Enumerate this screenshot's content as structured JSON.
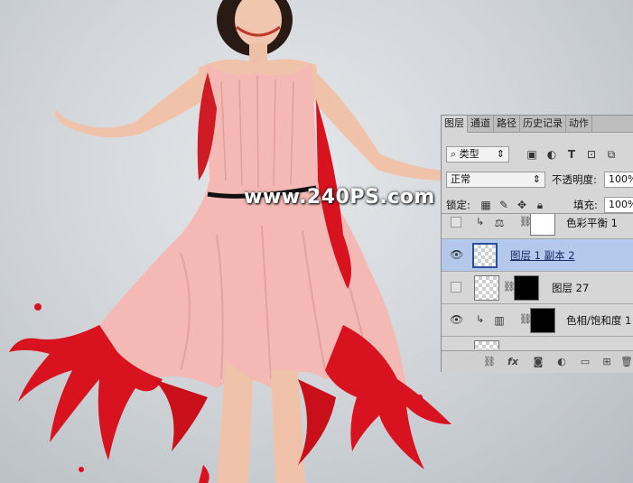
{
  "watermark": "www.240PS.com",
  "panel": {
    "tabs": [
      "图层",
      "通道",
      "路径",
      "历史记录",
      "动作"
    ],
    "filter": {
      "icon": "search-icon",
      "label": "类型"
    },
    "blend_mode": "正常",
    "opacity_label": "不透明度:",
    "opacity_value": "100%",
    "lock_label": "锁定:",
    "fill_label": "填充:",
    "fill_value": "100%",
    "layers": [
      {
        "name": "色彩平衡 1",
        "visible": false,
        "clipped": true,
        "selected": false
      },
      {
        "name": "图层 1 副本 2",
        "visible": true,
        "clipped": false,
        "selected": true
      },
      {
        "name": "图层 27",
        "visible": false,
        "clipped": false,
        "selected": false
      },
      {
        "name": "色相/饱和度 1",
        "visible": true,
        "clipped": true,
        "selected": false
      }
    ],
    "footer_icons": [
      "link-icon",
      "fx-icon",
      "mask-icon",
      "adjustment-icon",
      "folder-icon",
      "new-layer-icon",
      "trash-icon"
    ]
  },
  "colors": {
    "selected_row": "#b3c8ea",
    "dress": "#f4b9b4",
    "paint": "#d8121e"
  }
}
